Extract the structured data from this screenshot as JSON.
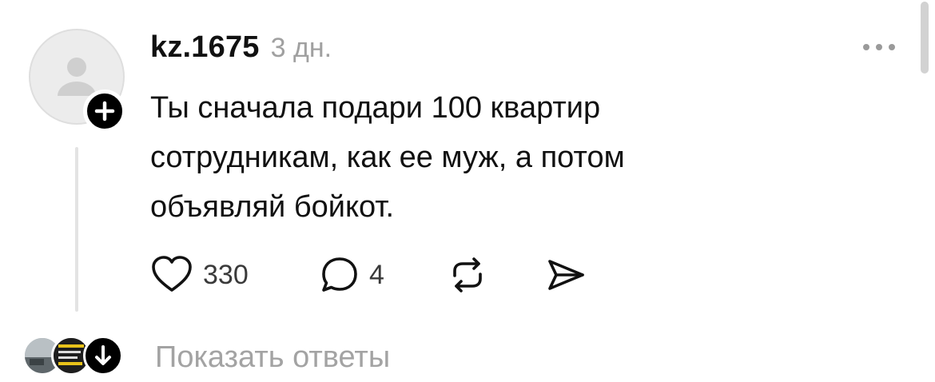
{
  "comment": {
    "username": "kz.1675",
    "time": "3 дн.",
    "text": "Ты сначала подари 100 квартир\nсотрудникам, как ее муж, а потом\nобъявляй бойкот.",
    "likes": "330",
    "replies": "4"
  },
  "icons": {
    "avatar": "default-user-icon",
    "follow": "plus-icon",
    "more": "more-dots-icon",
    "like": "heart-icon",
    "comment": "speech-bubble-icon",
    "repost": "repost-icon",
    "share": "send-icon",
    "expand": "arrow-down-icon"
  },
  "footer": {
    "show_replies_label": "Показать ответы"
  },
  "colors": {
    "text": "#111111",
    "muted": "#a0a0a0",
    "accent": "#000000"
  }
}
